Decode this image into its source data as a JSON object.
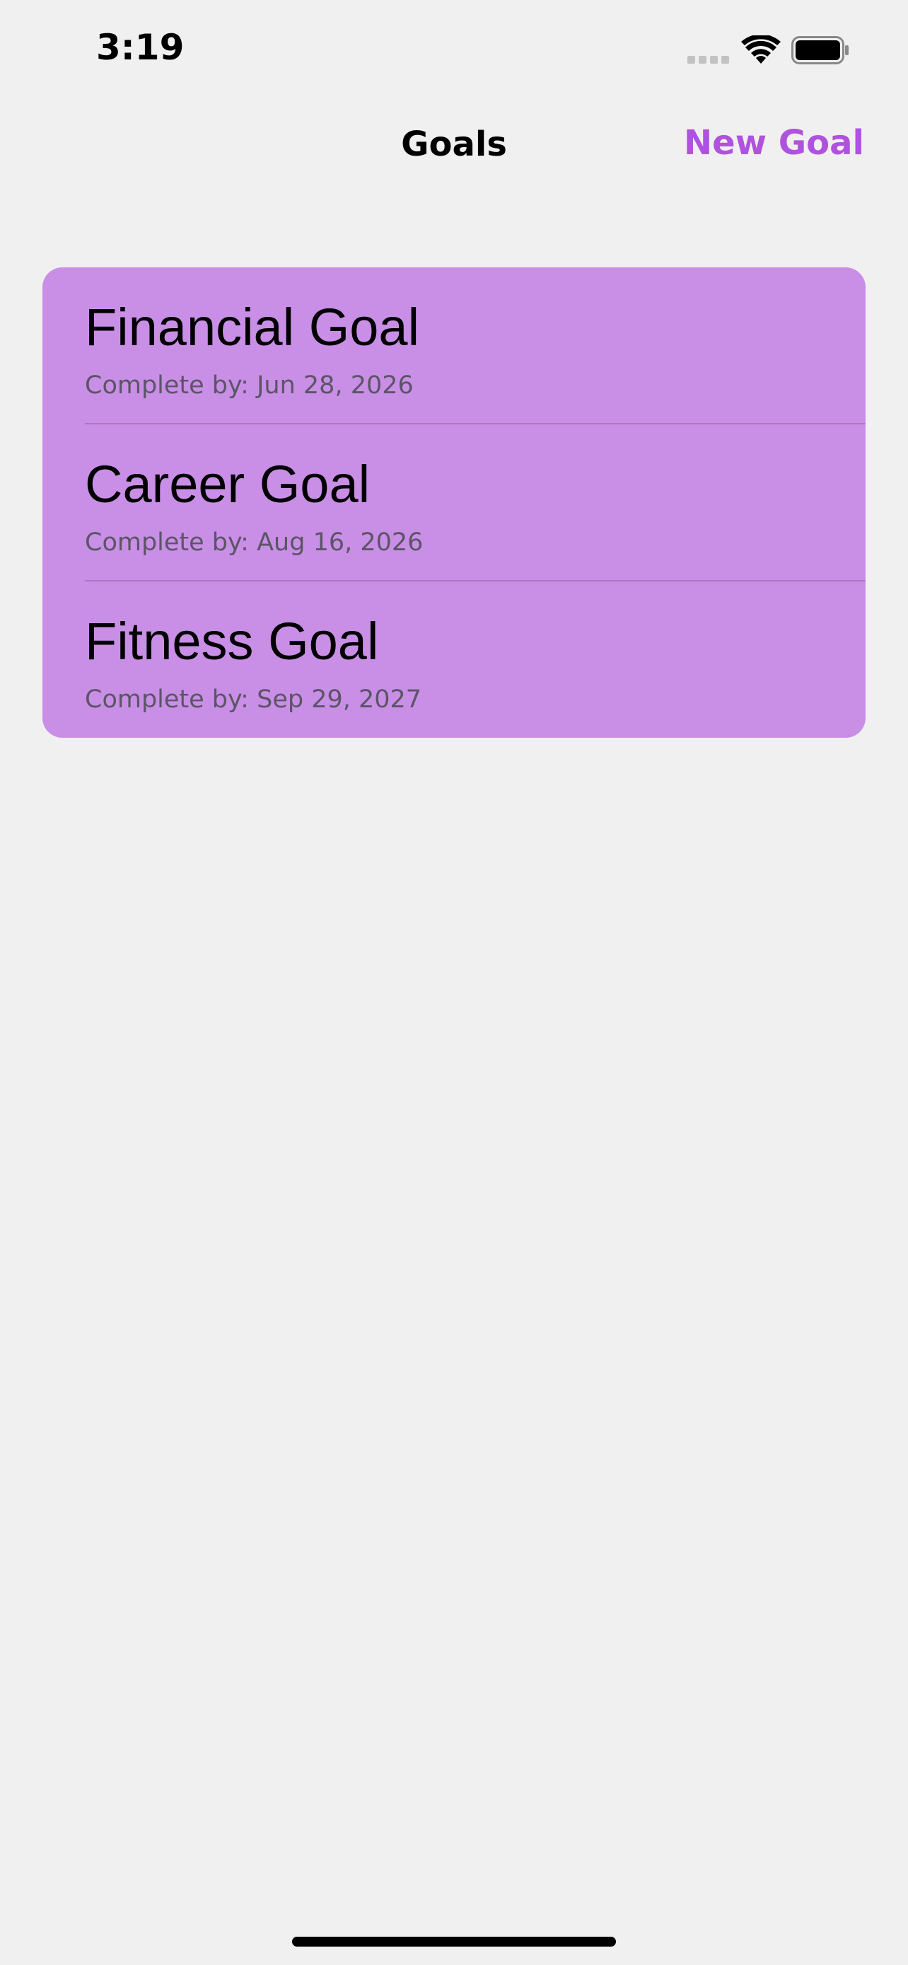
{
  "status_bar": {
    "time": "3:19"
  },
  "nav": {
    "title": "Goals",
    "new_goal_label": "New Goal"
  },
  "colors": {
    "accent": "#af52de",
    "list_background": "#c98fe6",
    "page_background": "#f0f0f0"
  },
  "goals": [
    {
      "title": "Financial Goal",
      "date": "Complete by: Jun 28, 2026"
    },
    {
      "title": "Career Goal",
      "date": "Complete by: Aug 16, 2026"
    },
    {
      "title": "Fitness Goal",
      "date": "Complete by: Sep 29, 2027"
    }
  ]
}
